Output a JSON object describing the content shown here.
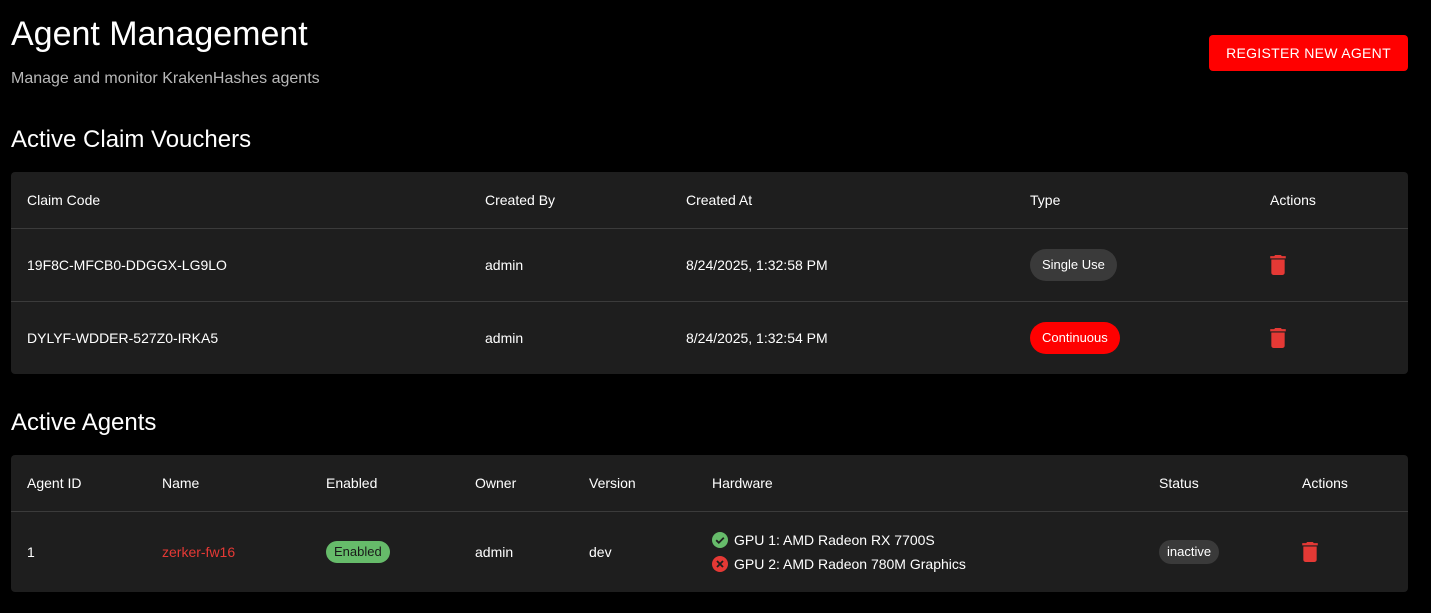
{
  "header": {
    "title": "Agent Management",
    "subtitle": "Manage and monitor KrakenHashes agents",
    "register_label": "REGISTER NEW AGENT"
  },
  "vouchers": {
    "title": "Active Claim Vouchers",
    "columns": [
      "Claim Code",
      "Created By",
      "Created At",
      "Type",
      "Actions"
    ],
    "rows": [
      {
        "code": "19F8C-MFCB0-DDGGX-LG9LO",
        "created_by": "admin",
        "created_at": "8/24/2025, 1:32:58 PM",
        "type": "Single Use"
      },
      {
        "code": "DYLYF-WDDER-527Z0-IRKA5",
        "created_by": "admin",
        "created_at": "8/24/2025, 1:32:54 PM",
        "type": "Continuous"
      }
    ]
  },
  "agents": {
    "title": "Active Agents",
    "columns": [
      "Agent ID",
      "Name",
      "Enabled",
      "Owner",
      "Version",
      "Hardware",
      "Status",
      "Actions"
    ],
    "rows": [
      {
        "id": "1",
        "name": "zerker-fw16",
        "enabled": "Enabled",
        "owner": "admin",
        "version": "dev",
        "hardware": [
          {
            "label": "GPU 1: AMD Radeon RX 7700S",
            "status_icon": "check-circle-icon"
          },
          {
            "label": "GPU 2: AMD Radeon 780M Graphics",
            "status_icon": "cancel-circle-icon"
          }
        ],
        "status": "inactive"
      }
    ]
  },
  "colors": {
    "accent": "#ff0000",
    "success": "#66bb6a",
    "error": "#e53935",
    "panel": "#1e1e1e"
  }
}
